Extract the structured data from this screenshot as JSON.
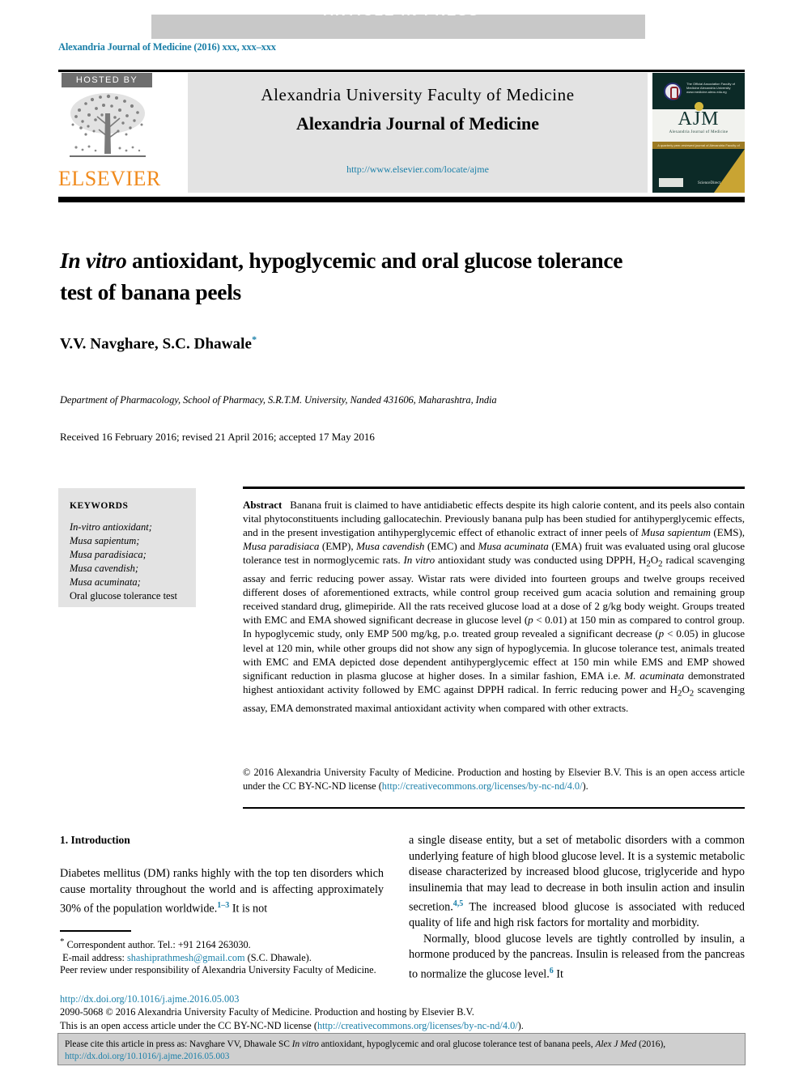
{
  "banner": {
    "label": "ARTICLE  IN  PRESS",
    "background": "#c8c8c8",
    "text_color": "#ffffff"
  },
  "running_head": "Alexandria Journal of Medicine (2016) xxx, xxx–xxx",
  "masthead": {
    "hosted_by": "HOSTED BY",
    "publisher": "ELSEVIER",
    "publisher_color": "#f08a1c",
    "society_line": "Alexandria University Faculty of Medicine",
    "journal_name": "Alexandria Journal of Medicine",
    "journal_url": "http://www.elsevier.com/locate/ajme",
    "cover": {
      "association_text": "The Official Association Faculty of Medicine Alexandria University www.medicine.alexu.edu.eg",
      "acronym": "AJM",
      "subtitle": "Alexandria Journal of Medicine",
      "strip_text": "A quarterly peer-reviewed journal of Alexandria Faculty of Medicine",
      "footer_text": "ScienceDirect"
    }
  },
  "article": {
    "title_part1_italic": "In vitro",
    "title_rest": " antioxidant, hypoglycemic and oral glucose tolerance test of banana peels",
    "authors": "V.V. Navghare, S.C. Dhawale",
    "author_marker": "*",
    "affiliation": "Department of Pharmacology, School of Pharmacy, S.R.T.M. University, Nanded 431606, Maharashtra, India",
    "history": "Received 16 February 2016; revised 21 April 2016; accepted 17 May 2016"
  },
  "keywords": {
    "heading": "KEYWORDS",
    "items": [
      "In-vitro antioxidant;",
      "Musa sapientum;",
      "Musa paradisiaca;",
      "Musa cavendish;",
      "Musa acuminata;",
      "Oral glucose tolerance test"
    ]
  },
  "abstract": {
    "label": "Abstract",
    "body": "Banana fruit is claimed to have antidiabetic effects despite its high calorie content, and its peels also contain vital phytoconstituents including gallocatechin. Previously banana pulp has been studied for antihyperglycemic effects, and in the present investigation antihyperglycemic effect of ethanolic extract of inner peels of Musa sapientum (EMS), Musa paradisiaca (EMP), Musa cavendish (EMC) and Musa acuminata (EMA) fruit was evaluated using oral glucose tolerance test in normoglycemic rats. In vitro antioxidant study was conducted using DPPH, H2O2 radical scavenging assay and ferric reducing power assay. Wistar rats were divided into fourteen groups and twelve groups received different doses of aforementioned extracts, while control group received gum acacia solution and remaining group received standard drug, glimepiride. All the rats received glucose load at a dose of 2 g/kg body weight. Groups treated with EMC and EMA showed significant decrease in glucose level (p < 0.01) at 150 min as compared to control group. In hypoglycemic study, only EMP 500 mg/kg, p.o. treated group revealed a significant decrease (p < 0.05) in glucose level at 120 min, while other groups did not show any sign of hypoglycemia. In glucose tolerance test, animals treated with EMC and EMA depicted dose dependent antihyperglycemic effect at 150 min while EMS and EMP showed significant reduction in plasma glucose at higher doses. In a similar fashion, EMA i.e. M. acuminata demonstrated highest antioxidant activity followed by EMC against DPPH radical. In ferric reducing power and H2O2 scavenging assay, EMA demonstrated maximal antioxidant activity when compared with other extracts.",
    "copyright": "© 2016 Alexandria University Faculty of Medicine. Production and hosting by Elsevier B.V. This is an open access article under the CC BY-NC-ND license",
    "license_url": "http://creativecommons.org/licenses/by-nc-nd/4.0/"
  },
  "introduction": {
    "heading": "1. Introduction",
    "left_paragraph": "Diabetes mellitus (DM) ranks highly with the top ten disorders which cause mortality throughout the world and is affecting approximately 30% of the population worldwide.",
    "left_ref": "1–3",
    "left_tail": " It is not",
    "right_p1a": "a single disease entity, but a set of metabolic disorders with a common underlying feature of high blood glucose level. It is a systemic metabolic disease characterized by increased blood glucose, triglyceride and hypo insulinemia that may lead to decrease in both insulin action and insulin secretion.",
    "right_ref1": "4,5",
    "right_p1b": " The increased blood glucose is associated with reduced quality of life and high risk factors for mortality and morbidity.",
    "right_p2a": "Normally, blood glucose levels are tightly controlled by insulin, a hormone produced by the pancreas. Insulin is released from the pancreas to normalize the glucose level.",
    "right_ref2": "6",
    "right_p2b": " It"
  },
  "footnotes": {
    "corresponding": "Correspondent author. Tel.: +91 2164 263030.",
    "email_label": "E-mail address:",
    "email": "shashiprathmesh@gmail.com",
    "email_attrib": "(S.C. Dhawale).",
    "peer_review": "Peer review under responsibility of Alexandria University Faculty of Medicine.",
    "doi": "http://dx.doi.org/10.1016/j.ajme.2016.05.003",
    "issn_line": "2090-5068 © 2016 Alexandria University Faculty of Medicine. Production and hosting by Elsevier B.V.",
    "license_line_prefix": "This is an open access article under the CC BY-NC-ND license (",
    "license_line_url": "http://creativecommons.org/licenses/by-nc-nd/4.0/",
    "license_line_suffix": ")."
  },
  "citation_footer": {
    "prefix": "Please cite this article in press as: Navghare VV, Dhawale SC ",
    "italic1": "In vitro",
    "middle": " antioxidant, hypoglycemic and oral glucose tolerance test of banana peels, ",
    "italic2": "Alex J Med",
    "suffix": " (2016),",
    "doi": "http://dx.doi.org/10.1016/j.ajme.2016.05.003"
  },
  "colors": {
    "link": "#1a7fa8",
    "banner_gray": "#c8c8c8",
    "panel_gray": "#e3e3e3",
    "footer_gray": "#cfcfcf"
  }
}
